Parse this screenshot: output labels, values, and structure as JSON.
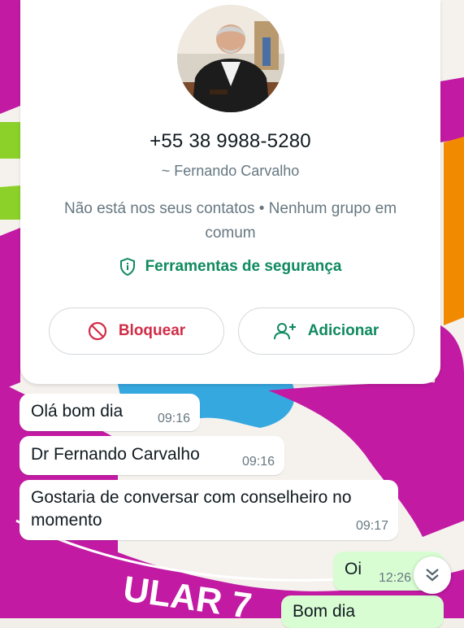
{
  "contact": {
    "phone": "+55 38 9988-5280",
    "push_name": "~ Fernando Carvalho",
    "notice": "Não está nos seus contatos • Nenhum grupo em comum",
    "security_label": "Ferramentas de segurança",
    "block_label": "Bloquear",
    "add_label": "Adicionar",
    "avatar_icon": "profile-photo"
  },
  "messages": [
    {
      "direction": "incoming",
      "text": "Olá bom dia",
      "time": "09:16"
    },
    {
      "direction": "incoming",
      "text": "Dr Fernando Carvalho",
      "time": "09:16"
    },
    {
      "direction": "incoming",
      "text": "Gostaria de conversar com conselheiro no momento",
      "time": "09:17"
    },
    {
      "direction": "outgoing",
      "text": "Oi",
      "time": "12:26"
    },
    {
      "direction": "outgoing",
      "text": "Bom dia",
      "time": ""
    }
  ],
  "wallpaper_text": "ULAR 7",
  "colors": {
    "accent_green": "#0f8a5f",
    "danger_red": "#d12c47",
    "outgoing_bubble": "#d9fdd3",
    "wallpaper_magenta": "#c21aa3",
    "wallpaper_blue": "#36a8e0",
    "wallpaper_orange": "#f28a00",
    "wallpaper_lime": "#8bd12a"
  },
  "icons": {
    "security": "shield-info-icon",
    "block": "block-icon",
    "add": "add-person-icon",
    "scroll": "double-chevron-down-icon"
  }
}
